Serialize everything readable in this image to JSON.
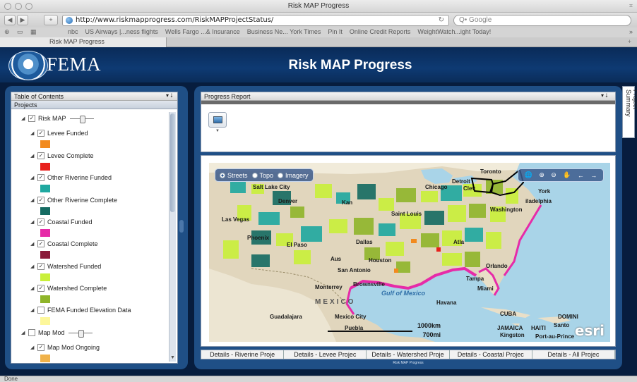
{
  "browser": {
    "window_title": "Risk MAP Progress",
    "url": "http://www.riskmapprogress.com/RiskMAPProjectStatus/",
    "search_placeholder": "Q• Google",
    "bookmarks": [
      "nbc",
      "US Airways |...ness flights",
      "Wells Fargo ...& Insurance",
      "Business Ne... York Times",
      "Pin It",
      "Online Credit Reports",
      "WeightWatch...ight Today!"
    ],
    "tab_label": "Risk MAP Progress",
    "status": "Done"
  },
  "header": {
    "logo_text": "FEMA",
    "title": "Risk MAP Progress"
  },
  "toc": {
    "title": "Table of Contents",
    "controls": "▾  ⭣",
    "section": "Projects",
    "items": [
      {
        "label": "Risk MAP",
        "checked": true,
        "slider": true,
        "color": null
      },
      {
        "label": "Levee Funded",
        "checked": true,
        "color": "#f28a1e"
      },
      {
        "label": "Levee Complete",
        "checked": true,
        "color": "#e8201c"
      },
      {
        "label": "Other Riverine Funded",
        "checked": true,
        "color": "#1fa8a0"
      },
      {
        "label": "Other Riverine Complete",
        "checked": true,
        "color": "#156b62"
      },
      {
        "label": "Coastal Funded",
        "checked": true,
        "color": "#e62ba8"
      },
      {
        "label": "Coastal Complete",
        "checked": true,
        "color": "#8b1a3a"
      },
      {
        "label": "Watershed Funded",
        "checked": true,
        "color": "#c9f03a"
      },
      {
        "label": "Watershed Complete",
        "checked": true,
        "color": "#8fb52a"
      },
      {
        "label": "FEMA Funded Elevation Data",
        "checked": false,
        "color": "#fdf79a"
      },
      {
        "label": "Map Mod",
        "checked": false,
        "slider": true,
        "color": null
      },
      {
        "label": "Map Mod Ongoing",
        "checked": true,
        "color": "#f0b24a"
      }
    ]
  },
  "progress": {
    "title": "Progress Report",
    "controls": "▾  ⭣"
  },
  "side_tab": "Project Summary",
  "map": {
    "basemaps": [
      {
        "label": "Streets",
        "selected": true
      },
      {
        "label": "Topo",
        "selected": false
      },
      {
        "label": "Imagery",
        "selected": false
      }
    ],
    "labels": {
      "toronto": "Toronto",
      "detroit": "Detroit",
      "chicago": "Chicago",
      "cleveland": "Clev",
      "new_york": "York",
      "philadelphia": "iladelphia",
      "washington": "Washington",
      "salt_lake": "Salt Lake City",
      "denver": "Denver",
      "kansas": "Kan",
      "saint_louis": "Saint Louis",
      "las_vegas": "Las Vegas",
      "phoenix": "Phoenix",
      "el_paso": "El Paso",
      "dallas": "Dallas",
      "atlanta": "Atla",
      "austin": "Aus",
      "houston": "Houston",
      "san_antonio": "San Antonio",
      "orlando": "Orlando",
      "tampa": "Tampa",
      "miami": "Miami",
      "brownsville": "Brownsville",
      "monterrey": "Monterrey",
      "gulf": "Gulf of Mexico",
      "mexico": "MEXICO",
      "havana": "Havana",
      "guadalajara": "Guadalajara",
      "mexico_city": "Mexico City",
      "puebla": "Puebla",
      "cuba": "CUBA",
      "jamaica": "JAMAICA",
      "kingston": "Kingston",
      "haiti": "HAITI",
      "dominican": "DOMINI",
      "santo": "Santo",
      "port_au_prince": "Port-au-Prince"
    },
    "scale_km": "1000km",
    "scale_mi": "700mi",
    "attribution": "esri"
  },
  "detail_tabs": [
    "Details - Riverine Proje",
    "Details - Levee Projec",
    "Details - Watershed Proje",
    "Details - Coastal Projec",
    "Details - All Projec"
  ],
  "footer_label": "Risk MAP Progress"
}
